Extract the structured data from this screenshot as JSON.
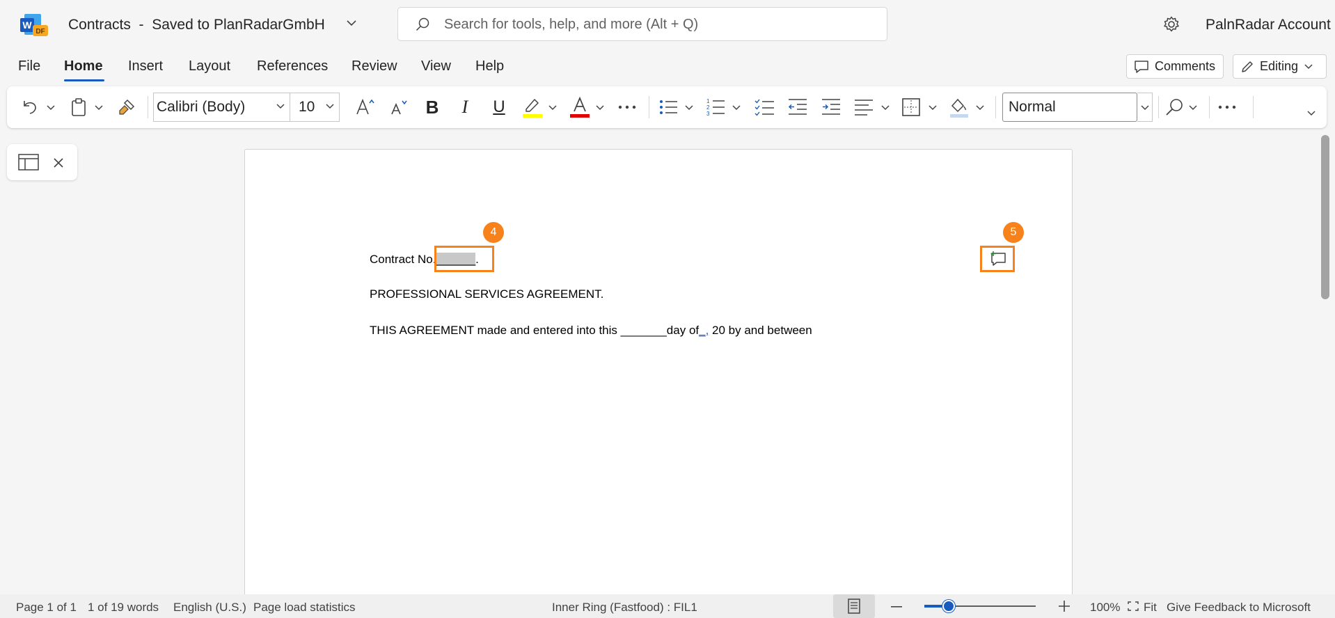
{
  "app": {
    "logo_letter": "W",
    "logo_badge": "DF",
    "doc_name": "Contracts",
    "separator": "-",
    "save_status": "Saved to PlanRadarGmbH",
    "account": "PalnRadar Account",
    "accent_color": "#185abd"
  },
  "search": {
    "placeholder": "Search for tools, help, and more (Alt + Q)"
  },
  "menu": {
    "tabs": [
      "File",
      "Home",
      "Insert",
      "Layout",
      "References",
      "Review",
      "View",
      "Help"
    ],
    "active": "Home",
    "comments_label": "Comments",
    "editing_label": "Editing"
  },
  "ribbon": {
    "font_name": "Calibri (Body)",
    "font_size": "10",
    "style_name": "Normal",
    "bold_glyph": "B",
    "italic_glyph": "I",
    "underline_glyph": "U",
    "highlight_color": "#ffff00",
    "font_color": "#e00000"
  },
  "document": {
    "line1_prefix": "Contract No.",
    "line1_blank": "______",
    "line1_end": ".",
    "line2": "PROFESSIONAL SERVICES AGREEMENT.",
    "line3_prefix": "THIS AGREEMENT made and entered into this _______day of",
    "line3_link": "_,",
    "line3_suffix": " 20 by and between"
  },
  "annotations": {
    "badge_a": "4",
    "badge_b": "5",
    "color": "#f7821b"
  },
  "status": {
    "page": "Page 1 of 1",
    "words": "1 of 19 words",
    "language": "English (U.S.)",
    "stats": "Page load statistics",
    "ring": "Inner Ring (Fastfood) : FIL1",
    "zoom": "100%",
    "zoom_fraction": 0.22,
    "fit": "Fit",
    "feedback": "Give Feedback to Microsoft"
  }
}
